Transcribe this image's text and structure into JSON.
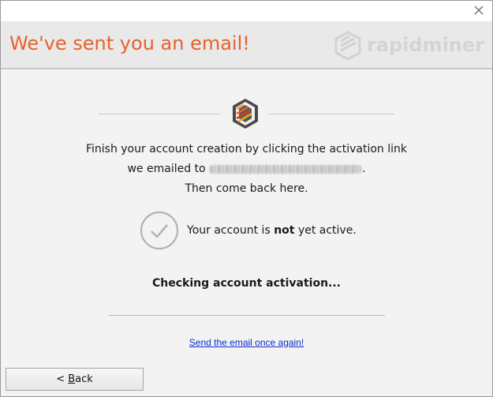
{
  "window": {
    "close_icon": "close-icon"
  },
  "header": {
    "title": "We've sent you an email!",
    "brand_name": "rapidminer",
    "title_color": "#e8622a"
  },
  "info": {
    "line1": "Finish your account creation by clicking the activation link",
    "line2_prefix": "we emailed to",
    "line2_suffix": ".",
    "line3": "Then come back here."
  },
  "status": {
    "icon": "checkmark-circle-icon",
    "text_before": "Your account is",
    "text_bold": "not",
    "text_after": "yet active."
  },
  "checking": {
    "text": "Checking account activation..."
  },
  "resend": {
    "link_text": "Send the email once again!",
    "color": "#0b2ccf"
  },
  "footer": {
    "back_label_prefix": "< ",
    "back_label_mnemonic": "B",
    "back_label_rest": "ack"
  }
}
